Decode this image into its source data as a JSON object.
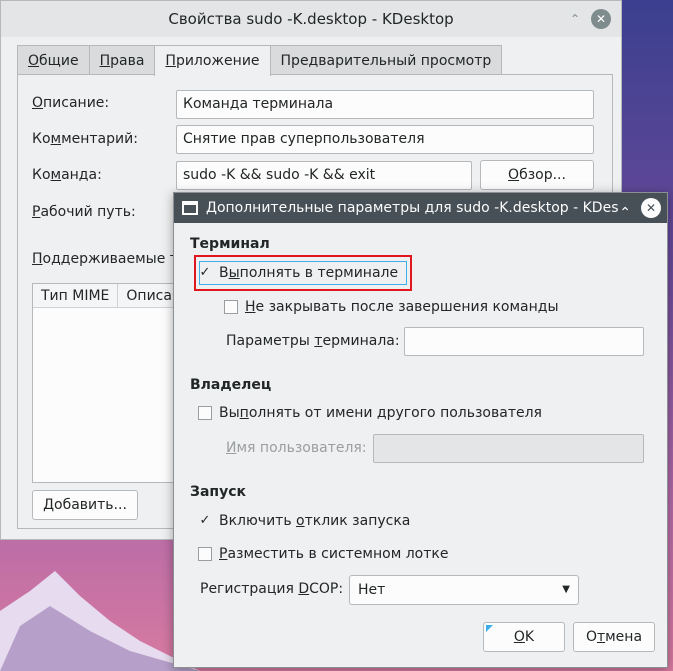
{
  "main_window": {
    "title": "Свойства sudo -K.desktop - KDesktop",
    "tabs": [
      {
        "pre": "",
        "u": "О",
        "post": "бщие"
      },
      {
        "pre": "",
        "u": "П",
        "post": "рава"
      },
      {
        "pre": "",
        "u": "П",
        "post": "риложение"
      },
      {
        "pre": "",
        "u": "",
        "post": "Предварительный просмотр"
      }
    ],
    "description_label": {
      "pre": "",
      "u": "О",
      "post": "писание:"
    },
    "description_value": "Команда терминала",
    "comment_label": {
      "pre": "Ко",
      "u": "м",
      "post": "ментарий:"
    },
    "comment_value": "Снятие прав суперпользователя",
    "command_label": {
      "pre": "Ко",
      "u": "м",
      "post": "анда:"
    },
    "command_value": "sudo -K && sudo -K && exit",
    "browse_button": {
      "pre": "",
      "u": "О",
      "post": "бзор..."
    },
    "workdir_label": {
      "pre": "",
      "u": "Р",
      "post": "абочий путь:"
    },
    "supported_label": {
      "pre": "",
      "u": "П",
      "post": "оддерживаемые т"
    },
    "mime_columns": [
      "Тип MIME",
      "Описа"
    ],
    "add_button": {
      "pre": "",
      "u": "Д",
      "post": "обавить..."
    }
  },
  "dialog": {
    "title": "Дополнительные параметры для sudo -K.desktop - KDes",
    "terminal_section": "Терминал",
    "run_in_terminal": {
      "pre": "В",
      "u": "ы",
      "post": "полнять в терминале",
      "checked": true
    },
    "keep_open": {
      "pre": "",
      "u": "Н",
      "post": "е закрывать после завершения команды",
      "checked": false
    },
    "terminal_options_label": {
      "pre": "Параметры ",
      "u": "т",
      "post": "ерминала:"
    },
    "terminal_options_value": "",
    "owner_section": "Владелец",
    "run_as_other": {
      "pre": "Вы",
      "u": "п",
      "post": "олнять от имени другого пользователя",
      "checked": false
    },
    "username_label": {
      "pre": "",
      "u": "И",
      "post": "мя пользователя:"
    },
    "username_value": "",
    "launch_section": "Запуск",
    "launch_feedback": {
      "pre": "Включить ",
      "u": "о",
      "post": "тклик запуска",
      "checked": true
    },
    "system_tray": {
      "pre": "",
      "u": "Р",
      "post": "азместить в системном лотке",
      "checked": false
    },
    "dcop_label": {
      "pre": "Регистрация ",
      "u": "D",
      "post": "COP:"
    },
    "dcop_value": "Нет",
    "ok_button": {
      "pre": "",
      "u": "O",
      "post": "K"
    },
    "cancel_button": {
      "pre": "О",
      "u": "т",
      "post": "мена"
    }
  },
  "colors": {
    "highlight": "#e0171e",
    "accent": "#3daee9",
    "dialog_title_bg": "#475057"
  },
  "icons": [
    "minimize-icon",
    "close-icon",
    "window-icon",
    "checkmark-icon",
    "dropdown-arrow-icon"
  ]
}
